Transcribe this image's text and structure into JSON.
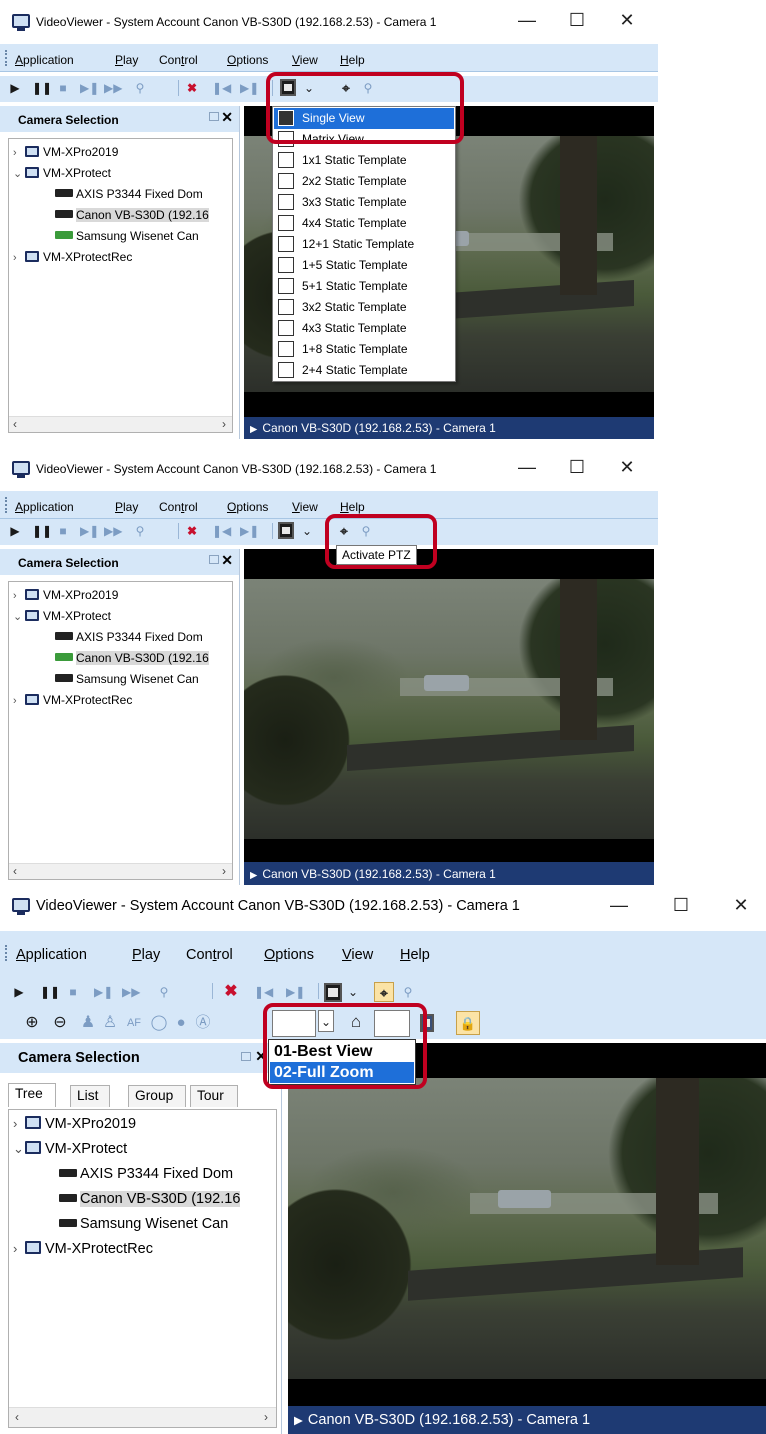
{
  "title": "VideoViewer - System Account Canon VB-S30D (192.168.2.53) - Camera 1",
  "window_controls": {
    "minimize": "—",
    "maximize": "☐",
    "close": "✕"
  },
  "menu": {
    "application_pre": "",
    "application_u": "A",
    "application_post": "pplication",
    "play_pre": "",
    "play_u": "P",
    "play_post": "lay",
    "control_pre": "Con",
    "control_u": "t",
    "control_post": "rol",
    "options_pre": "",
    "options_u": "O",
    "options_post": "ptions",
    "view_pre": "",
    "view_u": "V",
    "view_post": "iew",
    "help_pre": "",
    "help_u": "H",
    "help_post": "elp"
  },
  "toolbar_glyphs": {
    "play": "▶",
    "pause": "❚❚",
    "stop": "■",
    "step": "▶❚",
    "fast": "▶▶",
    "find": "⚲",
    "delete": "✖",
    "prev": "❚◀",
    "next": "▶❚",
    "dropdown": "⌄",
    "ptz": "⌖",
    "zoom": "⚲"
  },
  "ptz_toolbar_glyphs": {
    "zoom_in": "⊕",
    "zoom_out": "⊖",
    "person": "♟",
    "focus": "♙",
    "af": "AF",
    "iris_open": "◯",
    "iris_close": "●",
    "auto": "Ⓐ",
    "preset_arrow": "⌄",
    "home": "⌂",
    "lock": "🔒"
  },
  "left_pane": {
    "title": "Camera Selection",
    "close": "✕",
    "tabs": [
      "Tree",
      "List",
      "Group",
      "Tour"
    ],
    "tree": [
      {
        "label": "VM-XPro2019",
        "level": 0,
        "type": "server",
        "expander": "›"
      },
      {
        "label": "VM-XProtect",
        "level": 0,
        "type": "server",
        "expander": "⌄"
      },
      {
        "label": "AXIS P3344 Fixed Dom",
        "level": 1,
        "type": "camera",
        "active": false
      },
      {
        "label": "Canon VB-S30D (192.16",
        "level": 1,
        "type": "camera",
        "active": true
      },
      {
        "label": "Samsung Wisenet Can",
        "level": 1,
        "type": "camera",
        "active": false
      },
      {
        "label": "VM-XProtectRec",
        "level": 0,
        "type": "server",
        "expander": "›"
      }
    ],
    "scroll_left": "‹",
    "scroll_right": "›"
  },
  "video_caption": "Canon VB-S30D (192.168.2.53) - Camera 1",
  "view_menu": {
    "items": [
      {
        "label": "Single View",
        "selected": true
      },
      {
        "label": "Matrix View",
        "selected": false
      },
      {
        "label": "1x1 Static Template",
        "selected": false
      },
      {
        "label": "2x2 Static Template",
        "selected": false
      },
      {
        "label": "3x3 Static Template",
        "selected": false
      },
      {
        "label": "4x4 Static Template",
        "selected": false
      },
      {
        "label": "12+1 Static Template",
        "selected": false
      },
      {
        "label": "1+5 Static Template",
        "selected": false
      },
      {
        "label": "5+1 Static Template",
        "selected": false
      },
      {
        "label": "3x2 Static Template",
        "selected": false
      },
      {
        "label": "4x3 Static Template",
        "selected": false
      },
      {
        "label": "1+8 Static Template",
        "selected": false
      },
      {
        "label": "2+4 Static Template",
        "selected": false
      }
    ]
  },
  "tooltip": "Activate PTZ",
  "ptz_presets": {
    "items": [
      {
        "label": "01-Best View",
        "selected": false
      },
      {
        "label": "02-Full Zoom",
        "selected": true
      }
    ]
  },
  "colors": {
    "accent": "#1e6fd9",
    "highlight": "#c00020",
    "caption_bg": "#1e3a73",
    "toolbar_bg": "#d6e7f8"
  }
}
